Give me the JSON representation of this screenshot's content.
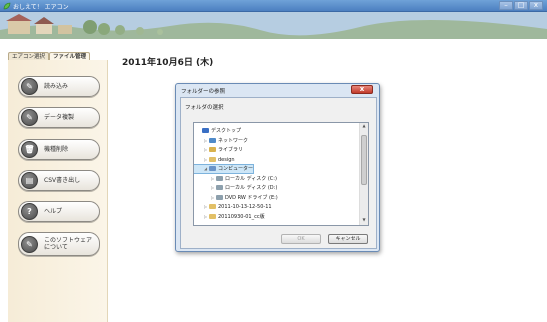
{
  "window": {
    "title": "おしえて！ エアコン",
    "buttons": {
      "minimize": "–",
      "maximize": "□",
      "close": "x"
    }
  },
  "tabs": [
    {
      "label": "エアコン選択"
    },
    {
      "label": "ファイル管理"
    }
  ],
  "sidebar": {
    "buttons": [
      {
        "label": "読み込み",
        "icon": "pencil-icon"
      },
      {
        "label": "データ複製",
        "icon": "pencil-icon"
      },
      {
        "label": "機種削除",
        "icon": "trash-icon"
      },
      {
        "label": "CSV書き出し",
        "icon": "document-icon"
      },
      {
        "label": "ヘルプ",
        "icon": "question-icon"
      },
      {
        "label": "このソフトウェア\nについて",
        "icon": "pencil-icon"
      }
    ]
  },
  "date": "2011年10月6日 (木)",
  "dialog": {
    "title": "フォルダーの参照",
    "close": "x",
    "prompt": "フォルダの選択",
    "tree": [
      {
        "label": "デスクトップ",
        "level": 0,
        "color": "#3a6fc4",
        "selected": false
      },
      {
        "label": "ネットワーク",
        "level": 1,
        "color": "#4f8ac9",
        "selected": false
      },
      {
        "label": "ライブラリ",
        "level": 1,
        "color": "#d9b24d",
        "selected": false
      },
      {
        "label": "design",
        "level": 1,
        "color": "#e2c067",
        "selected": false
      },
      {
        "label": "コンピューター",
        "level": 1,
        "color": "#6a94c8",
        "selected": true
      },
      {
        "label": "ローカル ディスク (C:)",
        "level": 2,
        "color": "#8da0ad",
        "selected": false
      },
      {
        "label": "ローカル ディスク (D:)",
        "level": 2,
        "color": "#8da0ad",
        "selected": false
      },
      {
        "label": "DVD RW ドライブ (E:)",
        "level": 2,
        "color": "#8da0ad",
        "selected": false
      },
      {
        "label": "2011-10-13-12-50-11",
        "level": 1,
        "color": "#e2c067",
        "selected": false
      },
      {
        "label": "20110930-01_cc版",
        "level": 1,
        "color": "#e2c067",
        "selected": false
      }
    ],
    "ok_label": "OK",
    "cancel_label": "キャンセル"
  }
}
